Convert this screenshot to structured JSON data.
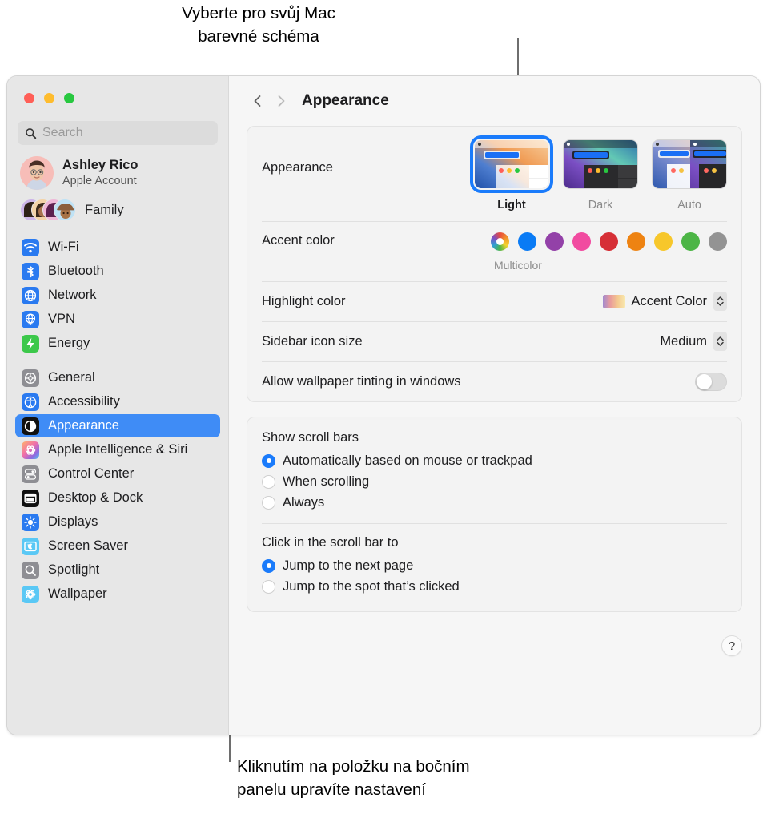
{
  "callouts": {
    "top": "Vyberte pro svůj Mac\nbarevné schéma",
    "bottom": "Kliknutím na položku na bočním\npanelu upravíte nastavení"
  },
  "window": {
    "traffic_lights": [
      "close-red",
      "minimize-yellow",
      "zoom-green"
    ]
  },
  "sidebar": {
    "search": {
      "placeholder": "Search",
      "value": ""
    },
    "account": {
      "name": "Ashley Rico",
      "subtitle": "Apple Account"
    },
    "family": {
      "label": "Family"
    },
    "groups": [
      {
        "items": [
          {
            "label": "Wi-Fi",
            "icon": "wifi-icon",
            "icon_bg": "#2a7af0",
            "selected": false
          },
          {
            "label": "Bluetooth",
            "icon": "bluetooth-icon",
            "icon_bg": "#2a7af0",
            "selected": false
          },
          {
            "label": "Network",
            "icon": "globe-icon",
            "icon_bg": "#2a7af0",
            "selected": false
          },
          {
            "label": "VPN",
            "icon": "vpn-globe-icon",
            "icon_bg": "#2a7af0",
            "selected": false
          },
          {
            "label": "Energy",
            "icon": "bolt-icon",
            "icon_bg": "#3cc84a",
            "selected": false
          }
        ]
      },
      {
        "items": [
          {
            "label": "General",
            "icon": "gear-icon",
            "icon_bg": "#8e8e93",
            "selected": false
          },
          {
            "label": "Accessibility",
            "icon": "accessibility-icon",
            "icon_bg": "#2a7af0",
            "selected": false
          },
          {
            "label": "Appearance",
            "icon": "appearance-icon",
            "icon_bg": "#111111",
            "selected": true
          },
          {
            "label": "Apple Intelligence & Siri",
            "icon": "siri-icon",
            "icon_bg": "#e9a0d8",
            "selected": false
          },
          {
            "label": "Control Center",
            "icon": "control-center-icon",
            "icon_bg": "#8e8e93",
            "selected": false
          },
          {
            "label": "Desktop & Dock",
            "icon": "desktop-dock-icon",
            "icon_bg": "#111111",
            "selected": false
          },
          {
            "label": "Displays",
            "icon": "brightness-icon",
            "icon_bg": "#2a7af0",
            "selected": false
          },
          {
            "label": "Screen Saver",
            "icon": "screen-saver-icon",
            "icon_bg": "#5ac8f5",
            "selected": false
          },
          {
            "label": "Spotlight",
            "icon": "search-icon",
            "icon_bg": "#8e8e93",
            "selected": false
          },
          {
            "label": "Wallpaper",
            "icon": "wallpaper-icon",
            "icon_bg": "#5ac8f5",
            "selected": false
          }
        ]
      }
    ]
  },
  "main": {
    "toolbar": {
      "back": "back-chevron",
      "forward": "forward-chevron",
      "title": "Appearance"
    },
    "appearance_row": {
      "label": "Appearance",
      "options": [
        {
          "label": "Light",
          "selected": true
        },
        {
          "label": "Dark",
          "selected": false
        },
        {
          "label": "Auto",
          "selected": false
        }
      ]
    },
    "accent_row": {
      "label": "Accent color",
      "caption": "Multicolor",
      "swatches": [
        {
          "name": "multicolor",
          "color": "multicolor",
          "selected": true
        },
        {
          "name": "blue",
          "color": "#0a7bf5"
        },
        {
          "name": "purple",
          "color": "#9341a8"
        },
        {
          "name": "pink",
          "color": "#f14ba0"
        },
        {
          "name": "red",
          "color": "#d62f36"
        },
        {
          "name": "orange",
          "color": "#ee8312"
        },
        {
          "name": "yellow",
          "color": "#f7c72b"
        },
        {
          "name": "green",
          "color": "#4cb546"
        },
        {
          "name": "graphite",
          "color": "#939393"
        }
      ]
    },
    "highlight_row": {
      "label": "Highlight color",
      "value": "Accent Color"
    },
    "sidebar_size_row": {
      "label": "Sidebar icon size",
      "value": "Medium"
    },
    "tint_row": {
      "label": "Allow wallpaper tinting in windows",
      "state": "off"
    },
    "scroll_card": {
      "show_scroll_bars": {
        "title": "Show scroll bars",
        "options": [
          {
            "label": "Automatically based on mouse or trackpad",
            "selected": true
          },
          {
            "label": "When scrolling",
            "selected": false
          },
          {
            "label": "Always",
            "selected": false
          }
        ]
      },
      "click_scroll_bar": {
        "title": "Click in the scroll bar to",
        "options": [
          {
            "label": "Jump to the next page",
            "selected": true
          },
          {
            "label": "Jump to the spot that’s clicked",
            "selected": false
          }
        ]
      }
    },
    "help_button": {
      "label": "?"
    }
  },
  "colors": {
    "accent": "#1a7bfb",
    "selection": "#3f8cf6",
    "sidebar_bg": "#e7e7e7",
    "main_bg": "#f6f6f6",
    "card_bg": "#f3f3f3"
  }
}
